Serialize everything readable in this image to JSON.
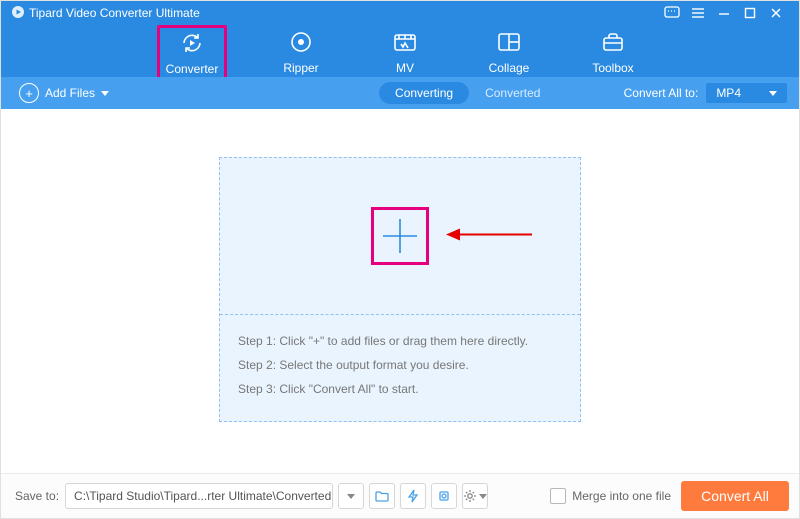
{
  "app": {
    "title": "Tipard Video Converter Ultimate"
  },
  "nav": {
    "converter": "Converter",
    "ripper": "Ripper",
    "mv": "MV",
    "collage": "Collage",
    "toolbox": "Toolbox"
  },
  "toolbar": {
    "add_files": "Add Files",
    "converting": "Converting",
    "converted": "Converted",
    "convert_all_to": "Convert All to:",
    "format": "MP4"
  },
  "steps": {
    "s1": "Step 1: Click \"+\" to add files or drag them here directly.",
    "s2": "Step 2: Select the output format you desire.",
    "s3": "Step 3: Click \"Convert All\" to start."
  },
  "footer": {
    "save_to_label": "Save to:",
    "path": "C:\\Tipard Studio\\Tipard...rter Ultimate\\Converted",
    "merge_label": "Merge into one file",
    "convert_all_btn": "Convert All"
  }
}
